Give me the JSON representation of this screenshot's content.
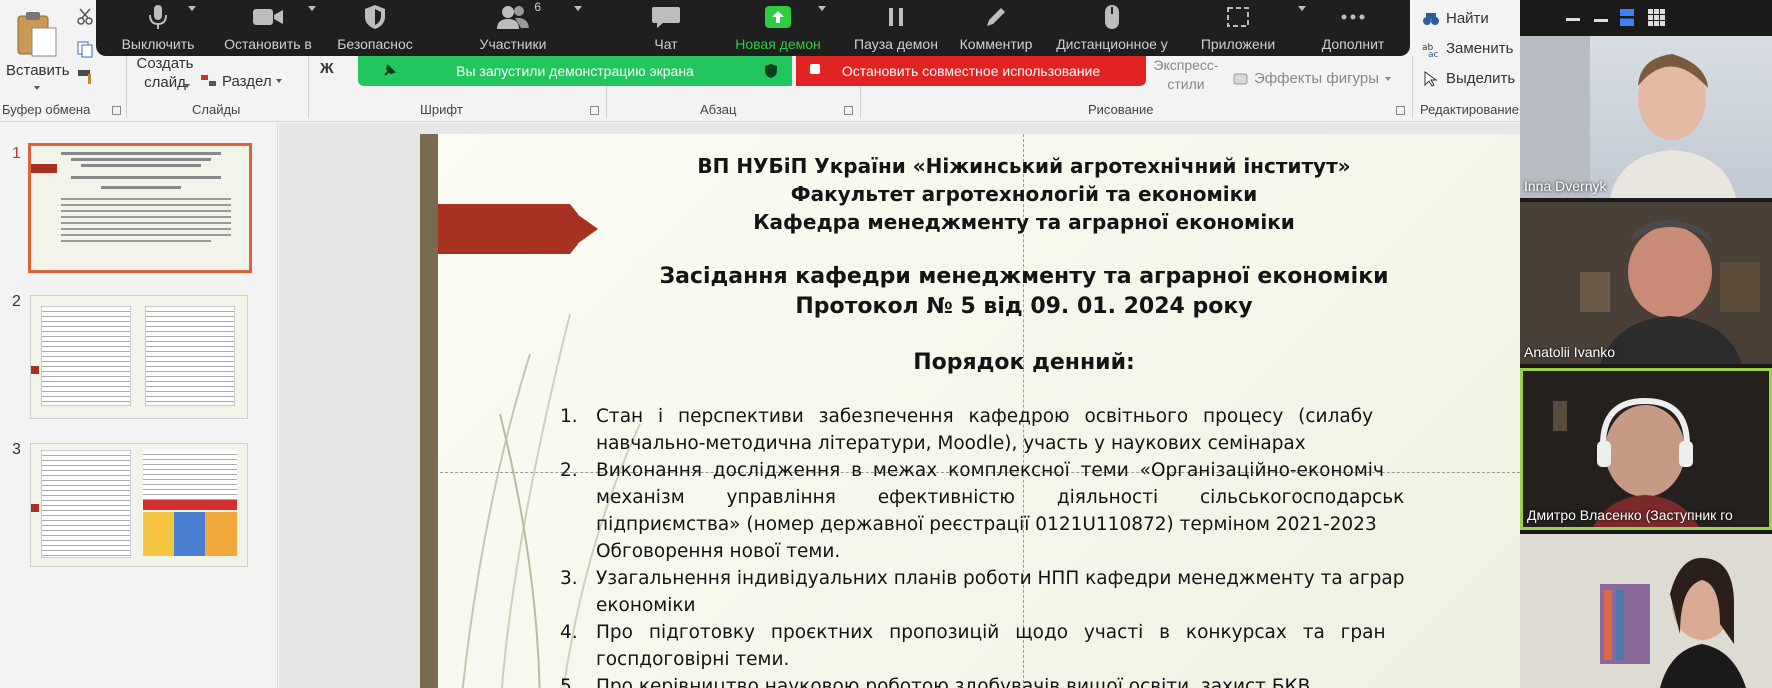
{
  "ribbon": {
    "paste_label": "Вставить",
    "create_slide_label": "Создать\nслайд",
    "section_label": "Раздел",
    "groups": [
      "Буфер обмена",
      "Слайды",
      "Шрифт",
      "Абзац",
      "Рисование",
      "Редактирование"
    ],
    "bold_glyph": "Ж",
    "express_styles_label": "Экспресс-\nстили",
    "shape_effects_label": "Эффекты фигуры",
    "find_label": "Найти",
    "replace_label": "Заменить",
    "select_label": "Выделить"
  },
  "zoom_toolbar": {
    "items": [
      {
        "label": "Выключить",
        "icon": "microphone-icon"
      },
      {
        "label": "Остановить в",
        "icon": "video-camera-icon"
      },
      {
        "label": "Безопаснос",
        "icon": "shield-icon"
      },
      {
        "label": "Участники",
        "icon": "participants-icon",
        "count": "6"
      },
      {
        "label": "Чат",
        "icon": "chat-icon"
      },
      {
        "label": "Новая демон",
        "icon": "share-screen-icon"
      },
      {
        "label": "Пауза демон",
        "icon": "pause-icon"
      },
      {
        "label": "Комментир",
        "icon": "annotate-icon"
      },
      {
        "label": "Дистанционное у",
        "icon": "remote-control-icon"
      },
      {
        "label": "Приложени",
        "icon": "apps-icon"
      },
      {
        "label": "Дополнит",
        "icon": "more-icon"
      }
    ]
  },
  "share_banner": {
    "status_text": "Вы запустили демонстрацию экрана",
    "stop_text": "Остановить совместное использование",
    "status_color": "#22c55e",
    "stop_color": "#e02424"
  },
  "thumbnails": {
    "items": [
      {
        "number": "1"
      },
      {
        "number": "2"
      },
      {
        "number": "3"
      }
    ],
    "active_index": 0
  },
  "slide": {
    "header_lines": [
      "ВП НУБіП України «Ніжинський агротехнічний інститут»",
      "Факультет агротехнологій та економіки",
      "Кафедра менеджменту та аграрної економіки"
    ],
    "meeting_lines": [
      "Засідання кафедри менеджменту та аграрної економіки",
      "Протокол № 5 від 09. 01. 2024 року"
    ],
    "agenda_title": "Порядок денний:",
    "agenda": [
      {
        "num": "1.",
        "lines": [
          "Стан і перспективи забезпечення кафедрою освітнього процесу (силабу",
          "навчально-методична літератури, Moodle), участь у наукових семінарах"
        ]
      },
      {
        "num": "2.",
        "lines": [
          "Виконання дослідження в межах комплексної теми «Організаційно-економіч",
          "механізм управління ефективністю діяльності сільськогосподарськ",
          "підприємства» (номер державної реєстрації 0121U110872) терміном 2021-2023",
          "Обговорення нової теми."
        ]
      },
      {
        "num": "3.",
        "lines": [
          "Узагальнення індивідуальних планів роботи НПП кафедри менеджменту та аграр",
          "економіки"
        ]
      },
      {
        "num": "4.",
        "lines": [
          "Про підготовку проєктних пропозицій щодо участі в конкурсах та гран",
          "госпдоговірні теми."
        ]
      },
      {
        "num": "5.",
        "lines": [
          "Про керівництво науковою роботою здобувачів вищої освіти, захист БКВ"
        ]
      }
    ]
  },
  "gallery": {
    "participants": [
      {
        "name": "Inna Dvernyk"
      },
      {
        "name": "Anatolii Ivanko"
      },
      {
        "name": "Дмитро Власенко (Заступник го"
      },
      {
        "name": ""
      }
    ],
    "active_speaker_color": "#9bd24a"
  }
}
